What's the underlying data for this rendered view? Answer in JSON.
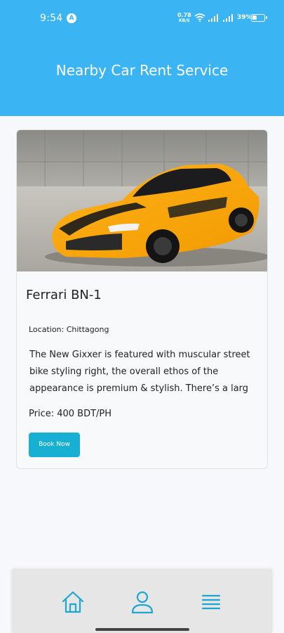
{
  "status_bar": {
    "time": "9:54",
    "app_badge": "A",
    "speed_value": "0.78",
    "speed_unit": "KB/S",
    "battery": "39%"
  },
  "header": {
    "title": "Nearby Car Rent Service"
  },
  "card": {
    "image_alt": "yellow sports car",
    "name": "Ferrari BN-1",
    "location": "Location: Chittagong",
    "description": "The New Gixxer is featured with muscular street bike styling right,  the overall ethos of the appearance is premium & stylish.  There’s a larg",
    "price": "Price: 400 BDT/PH",
    "book_label": "Book Now"
  },
  "bottom_nav": {
    "items": [
      {
        "icon": "home-icon"
      },
      {
        "icon": "user-icon"
      },
      {
        "icon": "menu-icon"
      }
    ]
  },
  "colors": {
    "header_bg": "#3ab4f2",
    "accent": "#17b0d3",
    "nav_icon": "#1ba7cf"
  }
}
